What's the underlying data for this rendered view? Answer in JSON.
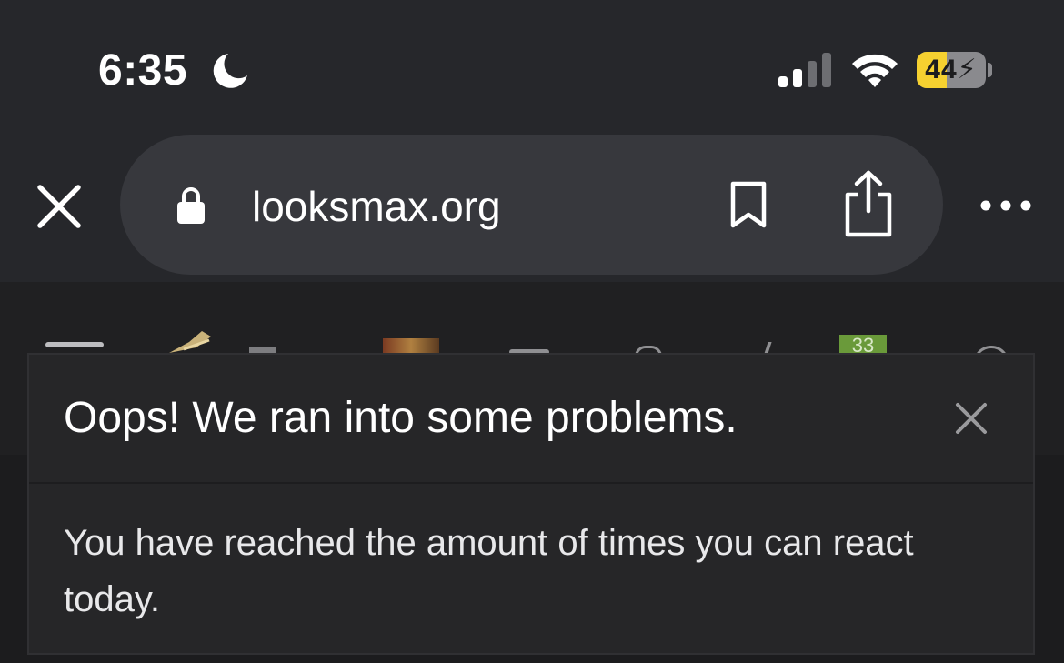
{
  "status_bar": {
    "time": "6:35",
    "focus_icon": "moon-icon",
    "signal_icon": "cellular-signal-icon",
    "wifi_icon": "wifi-icon",
    "battery": {
      "level": 44,
      "label": "44",
      "charging": true,
      "fill_color": "#f6d130"
    }
  },
  "browser": {
    "close_icon": "close-icon",
    "lock_icon": "lock-icon",
    "url": "looksmax.org",
    "bookmark_icon": "bookmark-icon",
    "share_icon": "share-icon",
    "more_icon": "more-icon"
  },
  "site_nav": {
    "badge_count": "33"
  },
  "error_overlay": {
    "title": "Oops! We ran into some problems.",
    "message": "You have reached the amount of times you can react today.",
    "close_icon": "close-icon"
  },
  "colors": {
    "chrome_bg": "#26272b",
    "url_pill_bg": "#37383d",
    "overlay_bg": "#262628",
    "badge_green": "#6a9a3a"
  }
}
